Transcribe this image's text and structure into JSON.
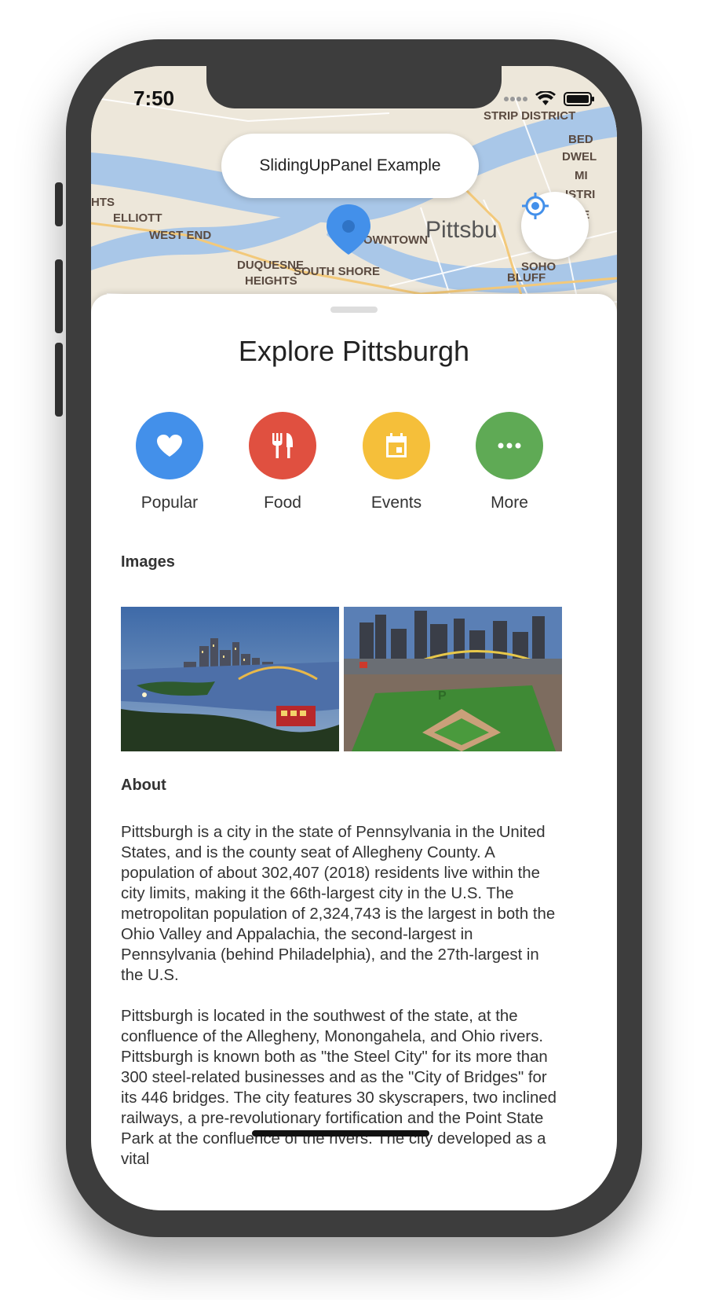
{
  "status": {
    "time": "7:50"
  },
  "map": {
    "title": "SlidingUpPanel Example",
    "labels": {
      "elliott": "ELLIOTT",
      "west_end": "WEST END",
      "downtown": "DOWNTOWN",
      "pittsburgh": "Pittsbu",
      "duquesne": "DUQUESNE",
      "heights": "HEIGHTS",
      "south_shore": "SOUTH SHORE",
      "soho": "SOHO",
      "bluff": "BLUFF",
      "hts": "HTS",
      "bed": "BED",
      "dwel": "DWEL",
      "mi": "MI",
      "istri": "ISTRI",
      "te": "TE",
      "strip_district": "STRIP DISTRICT"
    }
  },
  "panel": {
    "title": "Explore Pittsburgh",
    "categories": [
      {
        "label": "Popular",
        "icon": "heart-icon",
        "color": "#4390ea"
      },
      {
        "label": "Food",
        "icon": "restaurant-icon",
        "color": "#e05040"
      },
      {
        "label": "Events",
        "icon": "calendar-icon",
        "color": "#f5bf3a"
      },
      {
        "label": "More",
        "icon": "more-icon",
        "color": "#5faa55"
      }
    ],
    "images_heading": "Images",
    "about_heading": "About",
    "about_paragraphs": [
      "Pittsburgh is a city in the state of Pennsylvania in the United States, and is the county seat of Allegheny County. A population of about 302,407 (2018) residents live within the city limits, making it the 66th-largest city in the U.S. The metropolitan population of 2,324,743 is the largest in both the Ohio Valley and Appalachia, the second-largest in Pennsylvania (behind Philadelphia), and the 27th-largest in the U.S.",
      "Pittsburgh is located in the southwest of the state, at the confluence of the Allegheny, Monongahela, and Ohio rivers. Pittsburgh is known both as \"the Steel City\" for its more than 300 steel-related businesses and as the \"City of Bridges\" for its 446 bridges. The city features 30 skyscrapers, two inclined railways, a pre-revolutionary fortification and the Point State Park at the confluence of the rivers. The city developed as a vital"
    ]
  },
  "colors": {
    "accent": "#4390ea"
  }
}
